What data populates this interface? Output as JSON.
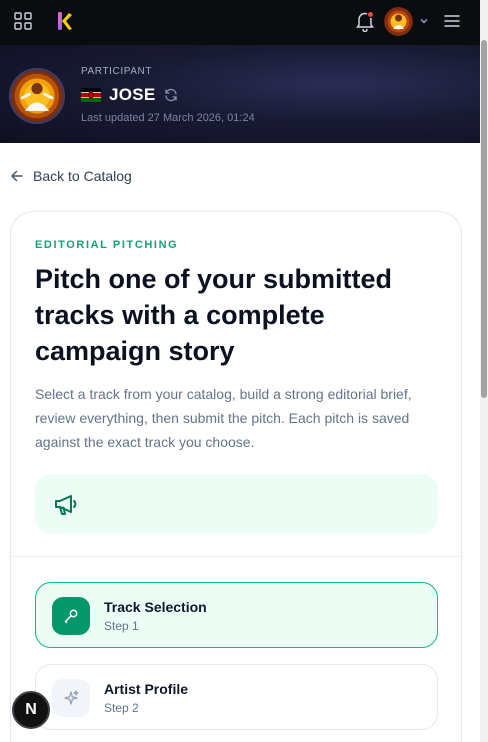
{
  "topbar": {
    "apps_icon": "apps-grid-icon",
    "brand_icon": "brand-logo-icon",
    "notifications_icon": "bell-icon",
    "notification_dot_color": "#ef4444",
    "menu_icon": "hamburger-menu-icon"
  },
  "profile": {
    "role": "PARTICIPANT",
    "name": "JOSE",
    "country_flag": "kenya-flag-icon",
    "last_updated": "Last updated 27 March 2026, 01:24"
  },
  "nav": {
    "back_label": "Back to Catalog"
  },
  "pitch": {
    "eyebrow": "EDITORIAL PITCHING",
    "headline": "Pitch one of your submitted tracks with a complete campaign story",
    "description": "Select a track from your catalog, build a strong editorial brief, review everything, then submit the pitch. Each pitch is saved against the exact track you choose.",
    "panel_icon": "megaphone-icon"
  },
  "steps": [
    {
      "title": "Track Selection",
      "subtitle": "Step 1",
      "icon": "microphone-icon",
      "active": true
    },
    {
      "title": "Artist Profile",
      "subtitle": "Step 2",
      "icon": "sparkles-icon",
      "active": false
    }
  ],
  "dev_badge": {
    "label": "N"
  },
  "colors": {
    "accent": "#10b981",
    "accent_dark": "#059669",
    "eyebrow": "#16a07a",
    "topbar_bg": "#0b0c10",
    "hero_bg": "#181a33"
  }
}
